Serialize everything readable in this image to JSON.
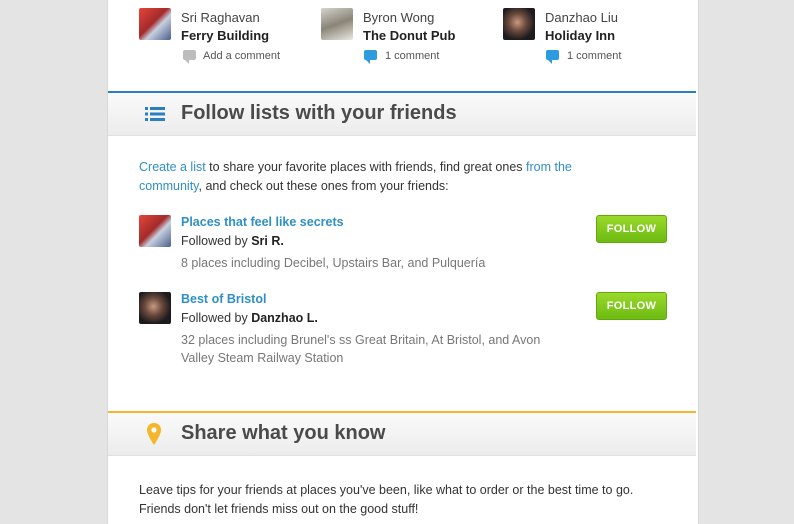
{
  "friends": [
    {
      "name": "Sri Raghavan",
      "place": "Ferry Building",
      "comment": "Add a comment"
    },
    {
      "name": "Byron Wong",
      "place": "The Donut Pub",
      "comment": "1 comment"
    },
    {
      "name": "Danzhao Liu",
      "place": "Holiday Inn",
      "comment": "1 comment"
    }
  ],
  "lists_section": {
    "title": "Follow lists with your friends",
    "intro_link1": "Create a list",
    "intro_text1": " to share your favorite places with friends, find great ones ",
    "intro_link2": "from the",
    "intro_link2b": "community",
    "intro_text2": ", and check out these ones from your friends:",
    "items": [
      {
        "title": "Places that feel like secrets",
        "followed_prefix": "Followed by ",
        "followed_name": "Sri R.",
        "desc": "8 places including Decibel, Upstairs Bar, and Pulquería",
        "button": "FOLLOW"
      },
      {
        "title": "Best of Bristol",
        "followed_prefix": "Followed by ",
        "followed_name": "Danzhao L.",
        "desc1": "32 places including Brunel's ss Great Britain, At Bristol, and Avon",
        "desc2": "Valley Steam Railway Station",
        "button": "FOLLOW"
      }
    ]
  },
  "share_section": {
    "title": "Share what you know",
    "line1": "Leave tips for your friends at places you've been, like what to order or the best time to go.",
    "line2": "Friends don't let friends miss out on the good stuff!"
  },
  "colors": {
    "lists_accent": "#2a7fc4",
    "share_accent": "#f4b62a",
    "follow_button": "#7cc51a",
    "link": "#2f8fc6"
  }
}
